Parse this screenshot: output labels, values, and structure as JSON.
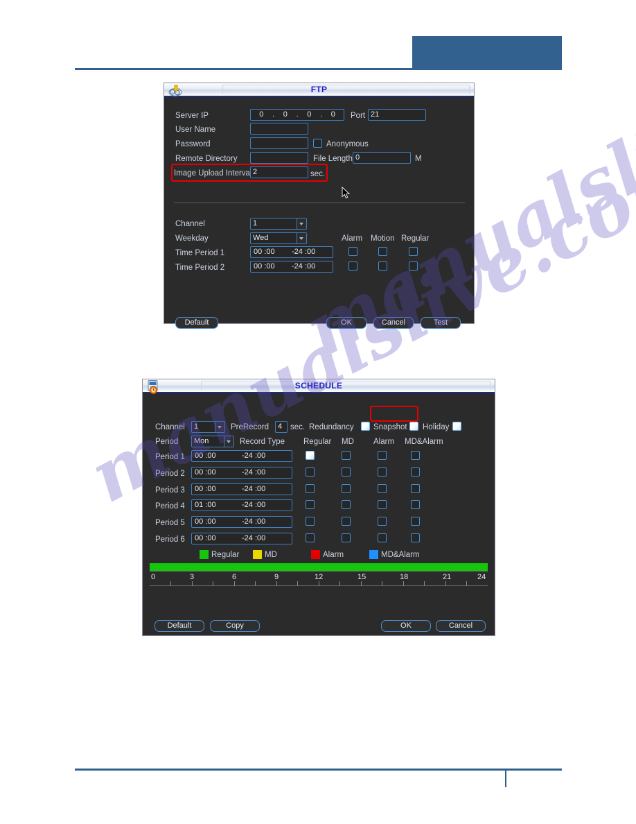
{
  "page": {
    "watermark_line1": "manualslive.com",
    "watermark_line2": "manualslive.com"
  },
  "ftp_dialog": {
    "title": "FTP",
    "icon": "ftp-upload-icon",
    "fields": {
      "server_ip_label": "Server IP",
      "server_ip_octets": [
        "0",
        "0",
        "0",
        "0"
      ],
      "port_label": "Port",
      "port_value": "21",
      "user_name_label": "User Name",
      "user_name_value": "",
      "password_label": "Password",
      "password_value": "",
      "anonymous_label": "Anonymous",
      "anonymous_checked": false,
      "remote_directory_label": "Remote Directory",
      "remote_directory_value": "",
      "file_length_label": "File Length",
      "file_length_value": "0",
      "file_length_unit": "M",
      "image_upload_interval_label": "Image Upload Interval",
      "image_upload_interval_value": "2",
      "image_upload_interval_unit": "sec.",
      "channel_label": "Channel",
      "channel_value": "1",
      "weekday_label": "Weekday",
      "weekday_value": "Wed"
    },
    "columns": {
      "alarm": "Alarm",
      "motion": "Motion",
      "regular": "Regular"
    },
    "periods": [
      {
        "label": "Time Period 1",
        "start": "00 :00",
        "end": "-24 :00",
        "alarm": false,
        "motion": false,
        "regular": false
      },
      {
        "label": "Time Period 2",
        "start": "00 :00",
        "end": "-24 :00",
        "alarm": false,
        "motion": false,
        "regular": false
      }
    ],
    "buttons": {
      "default": "Default",
      "ok": "OK",
      "cancel": "Cancel",
      "test": "Test"
    },
    "highlight_color": "#e50000"
  },
  "schedule_dialog": {
    "title": "SCHEDULE",
    "icon": "schedule-clock-icon",
    "header": {
      "channel_label": "Channel",
      "channel_value": "1",
      "prerecord_label": "PreRecord",
      "prerecord_value": "4",
      "prerecord_unit": "sec.",
      "redundancy_label": "Redundancy",
      "redundancy_checked": false,
      "snapshot_label": "Snapshot",
      "snapshot_checked": false,
      "holiday_label": "Holiday",
      "holiday_checked": false,
      "period_label": "Period",
      "period_value": "Mon",
      "record_type_label": "Record Type"
    },
    "columns": {
      "regular": "Regular",
      "md": "MD",
      "alarm": "Alarm",
      "md_alarm": "MD&Alarm"
    },
    "periods": [
      {
        "label": "Period 1",
        "start": "00 :00",
        "end": "-24 :00",
        "regular": true,
        "md": false,
        "alarm": false,
        "md_alarm": false
      },
      {
        "label": "Period 2",
        "start": "00 :00",
        "end": "-24 :00",
        "regular": false,
        "md": false,
        "alarm": false,
        "md_alarm": false
      },
      {
        "label": "Period 3",
        "start": "00 :00",
        "end": "-24 :00",
        "regular": false,
        "md": false,
        "alarm": false,
        "md_alarm": false
      },
      {
        "label": "Period 4",
        "start": "01 :00",
        "end": "-24 :00",
        "regular": false,
        "md": false,
        "alarm": false,
        "md_alarm": false
      },
      {
        "label": "Period 5",
        "start": "00 :00",
        "end": "-24 :00",
        "regular": false,
        "md": false,
        "alarm": false,
        "md_alarm": false
      },
      {
        "label": "Period 6",
        "start": "00 :00",
        "end": "-24 :00",
        "regular": false,
        "md": false,
        "alarm": false,
        "md_alarm": false
      }
    ],
    "legend": [
      {
        "label": "Regular",
        "color": "#16c60c"
      },
      {
        "label": "MD",
        "color": "#e8d800"
      },
      {
        "label": "Alarm",
        "color": "#e50000"
      },
      {
        "label": "MD&Alarm",
        "color": "#1e90ff"
      }
    ],
    "timeline": {
      "bar_color": "#16c60c",
      "bar_start_hour": 0,
      "bar_end_hour": 24,
      "ticks": [
        "0",
        "3",
        "6",
        "9",
        "12",
        "15",
        "18",
        "21",
        "24"
      ]
    },
    "buttons": {
      "default": "Default",
      "copy": "Copy",
      "ok": "OK",
      "cancel": "Cancel"
    },
    "highlight_color": "#e50000"
  }
}
